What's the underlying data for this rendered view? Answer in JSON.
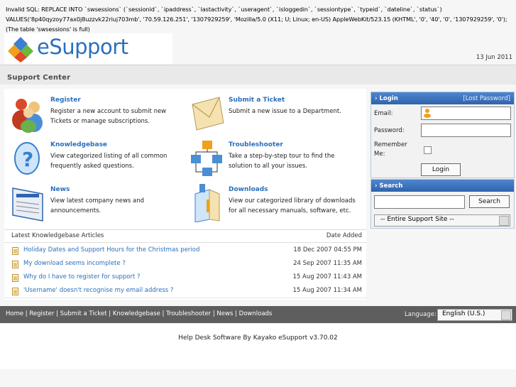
{
  "error_text": "Invalid SQL: REPLACE INTO `swsessions` (`sessionid`, `ipaddress`, `lastactivity`, `useragent`, `isloggedin`, `sessiontype`, `typeid`, `dateline`, `status`) VALUES('8p40qyzoy77ax0j8uzzvk22riuj703mb', '70.59.126.251', '1307929259', 'Mozilla/5.0 (X11; U; Linux; en-US) AppleWebKit/523.15 (KHTML', '0', '40', '0', '1307929259', '0'); (The table 'swsessions' is full)",
  "brand": {
    "logo_text": "eSupport",
    "logo_color": "#2a6fbd"
  },
  "date": "13 Jun 2011",
  "support_center_title": "Support Center",
  "features": [
    {
      "title": "Register",
      "desc": "Register a new account to submit new Tickets or manage subscriptions.",
      "icon": "users-icon"
    },
    {
      "title": "Submit a Ticket",
      "desc": "Submit a new issue to a Department.",
      "icon": "envelope-icon"
    },
    {
      "title": "Knowledgebase",
      "desc": "View categorized listing of all common frequently asked questions.",
      "icon": "question-icon"
    },
    {
      "title": "Troubleshooter",
      "desc": "Take a step-by-step tour to find the solution to all your issues.",
      "icon": "flowchart-icon"
    },
    {
      "title": "News",
      "desc": "View latest company news and announcements.",
      "icon": "newspaper-icon"
    },
    {
      "title": "Downloads",
      "desc": "View our categorized library of downloads for all necessary manuals, software, etc.",
      "icon": "box-icon"
    }
  ],
  "kb": {
    "header_left": "Latest Knowledgebase Articles",
    "header_right": "Date Added",
    "articles": [
      {
        "title": "Holiday Dates and Support Hours for the Christmas period",
        "date": "18 Dec 2007 04:55 PM"
      },
      {
        "title": "My download seems incomplete ?",
        "date": "24 Sep 2007 11:35 AM"
      },
      {
        "title": "Why do I have to register for support ?",
        "date": "15 Aug 2007 11:43 AM"
      },
      {
        "title": "'Username' doesn't recognise my email address ?",
        "date": "15 Aug 2007 11:34 AM"
      }
    ]
  },
  "login": {
    "heading": "Login",
    "lost_password": "[Lost Password]",
    "email_label": "Email:",
    "password_label": "Password:",
    "remember_label": "Remember Me:",
    "button": "Login"
  },
  "search": {
    "heading": "Search",
    "button": "Search",
    "scope": "-- Entire Support Site --"
  },
  "footer": {
    "links": "Home | Register | Submit a Ticket | Knowledgebase | Troubleshooter | News | Downloads",
    "language_label": "Language:",
    "language_value": "English (U.S.)"
  },
  "powered_by": "Help Desk Software By Kayako eSupport v3.70.02",
  "colors": {
    "link": "#2a6fbd",
    "panel_head": "#3a72bb",
    "footer_bg": "#5e5e5e"
  }
}
